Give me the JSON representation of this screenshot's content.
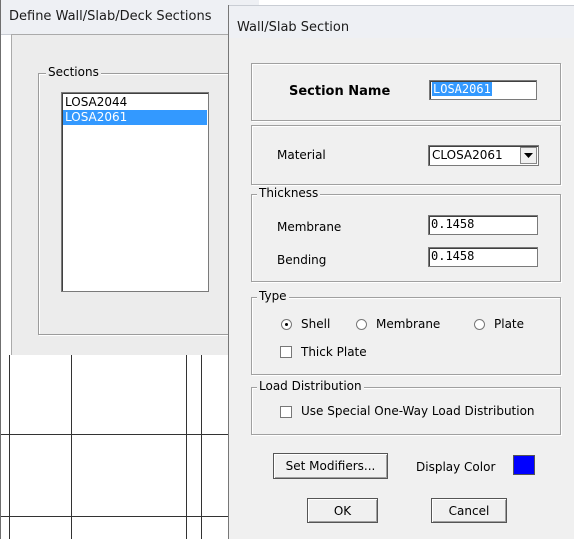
{
  "back_window": {
    "title": "Define Wall/Slab/Deck Sections",
    "sections_group_label": "Sections",
    "sections": [
      "LOSA2044",
      "LOSA2061"
    ],
    "selected_index": 1
  },
  "dialog": {
    "title": "Wall/Slab Section",
    "section_name_label": "Section Name",
    "section_name_value": "LOSA2061",
    "material_label": "Material",
    "material_value": "CLOSA2061",
    "thickness": {
      "group_label": "Thickness",
      "membrane_label": "Membrane",
      "membrane_value": "0.1458",
      "bending_label": "Bending",
      "bending_value": "0.1458"
    },
    "type": {
      "group_label": "Type",
      "options": [
        "Shell",
        "Membrane",
        "Plate"
      ],
      "selected": "Shell",
      "thick_plate_label": "Thick Plate",
      "thick_plate_checked": false
    },
    "load_distribution": {
      "group_label": "Load Distribution",
      "one_way_label": "Use Special One-Way Load Distribution",
      "one_way_checked": false
    },
    "set_modifiers_label": "Set Modifiers...",
    "display_color_label": "Display Color",
    "display_color": "#0000ff",
    "ok_label": "OK",
    "cancel_label": "Cancel"
  },
  "colors": {
    "selection": "#3399ff",
    "dialog_bg": "#f0f0f0"
  }
}
